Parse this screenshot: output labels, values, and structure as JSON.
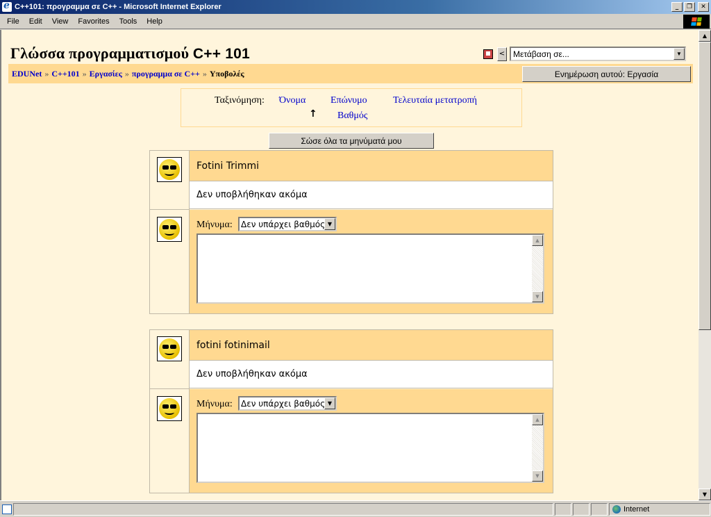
{
  "window": {
    "title": "C++101: προγραμμα σε C++ - Microsoft Internet Explorer",
    "minimize": "_",
    "maximize": "❐",
    "close": "✕"
  },
  "menu": [
    "File",
    "Edit",
    "View",
    "Favorites",
    "Tools",
    "Help"
  ],
  "header": {
    "course_title": "Γλώσσα προγραμματισμού",
    "course_code": "C++ 101",
    "prev_label": "<",
    "jump_select": "Μετάβαση σε...",
    "update_button": "Ενημέρωση αυτού: Εργασία"
  },
  "breadcrumb": {
    "items": [
      "EDUNet",
      "C++101",
      "Εργασίες",
      "προγραμμα σε C++"
    ],
    "separator": "»",
    "current": "Υποβολές"
  },
  "sort": {
    "label": "Ταξινόμηση:",
    "first_name": "Όνομα",
    "last_name": "Επώνυμο",
    "last_modified": "Τελευταία μετατροπή",
    "grade": "Βαθμός",
    "direction_icon": "↑"
  },
  "save_all_button": "Σώσε όλα τα μηνύματά μου",
  "submissions": [
    {
      "name": "Fotini Trimmi",
      "status": "Δεν υποβλήθηκαν ακόμα",
      "feedback_label": "Μήνυμα:",
      "grade": "Δεν υπάρχει βαθμός",
      "comment": ""
    },
    {
      "name": "fotini fotinimail",
      "status": "Δεν υποβλήθηκαν ακόμα",
      "feedback_label": "Μήνυμα:",
      "grade": "Δεν υπάρχει βαθμός",
      "comment": ""
    }
  ],
  "statusbar": {
    "zone": "Internet"
  },
  "colors": {
    "page_bg": "#fff5dc",
    "accent": "#ffd991",
    "link": "#0000cc"
  }
}
